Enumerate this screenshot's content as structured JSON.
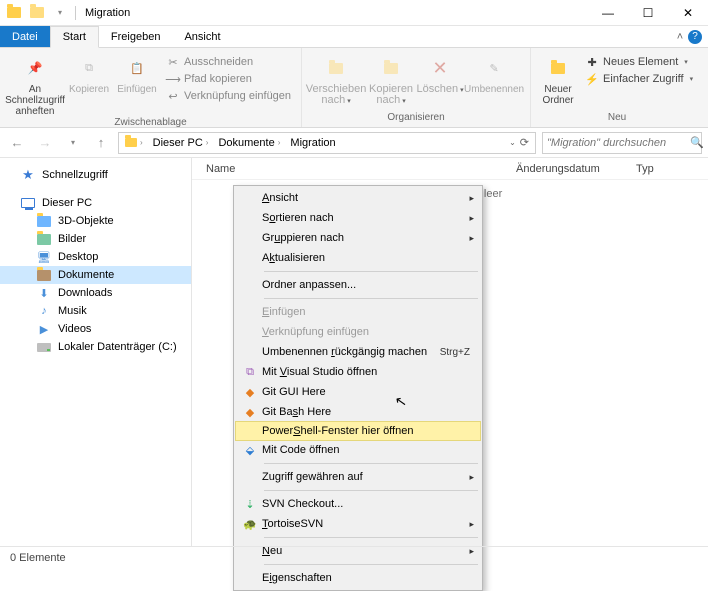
{
  "titlebar": {
    "title": "Migration"
  },
  "tabs": {
    "file": "Datei",
    "start": "Start",
    "share": "Freigeben",
    "view": "Ansicht"
  },
  "ribbon": {
    "clipboard": {
      "label": "Zwischenablage",
      "pin": "An Schnellzugriff\nanheften",
      "copy": "Kopieren",
      "paste": "Einfügen",
      "cut": "Ausschneiden",
      "copypath": "Pfad kopieren",
      "pastelink": "Verknüpfung einfügen"
    },
    "organize": {
      "label": "Organisieren",
      "move": "Verschieben\nnach",
      "copyto": "Kopieren\nnach",
      "delete": "Löschen",
      "rename": "Umbenennen"
    },
    "new": {
      "label": "Neu",
      "newfolder": "Neuer\nOrdner",
      "newitem": "Neues Element",
      "easyaccess": "Einfacher Zugriff"
    }
  },
  "nav": {
    "crumbs": [
      "Dieser PC",
      "Dokumente",
      "Migration"
    ],
    "search_placeholder": "\"Migration\" durchsuchen"
  },
  "tree": {
    "quick": "Schnellzugriff",
    "thispc": "Dieser PC",
    "items": [
      "3D-Objekte",
      "Bilder",
      "Desktop",
      "Dokumente",
      "Downloads",
      "Musik",
      "Videos",
      "Lokaler Datenträger (C:)"
    ]
  },
  "columns": {
    "name": "Name",
    "date": "Änderungsdatum",
    "type": "Typ"
  },
  "empty": "Dieser Ordner ist leer",
  "ctx": {
    "view": "Ansicht",
    "sort": "Sortieren nach",
    "group": "Gruppieren nach",
    "refresh": "Aktualisieren",
    "customize": "Ordner anpassen...",
    "paste": "Einfügen",
    "pastelink": "Verknüpfung einfügen",
    "undo": "Umbenennen rückgängig machen",
    "undo_key": "Strg+Z",
    "openvs": "Mit Visual Studio öffnen",
    "gitgui": "Git GUI Here",
    "gitbash": "Git Bash Here",
    "powershell": "PowerShell-Fenster hier öffnen",
    "opencode": "Mit Code öffnen",
    "grantaccess": "Zugriff gewähren auf",
    "svncheckout": "SVN Checkout...",
    "tortoise": "TortoiseSVN",
    "new": "Neu",
    "properties": "Eigenschaften"
  },
  "status": {
    "count": "0 Elemente"
  }
}
